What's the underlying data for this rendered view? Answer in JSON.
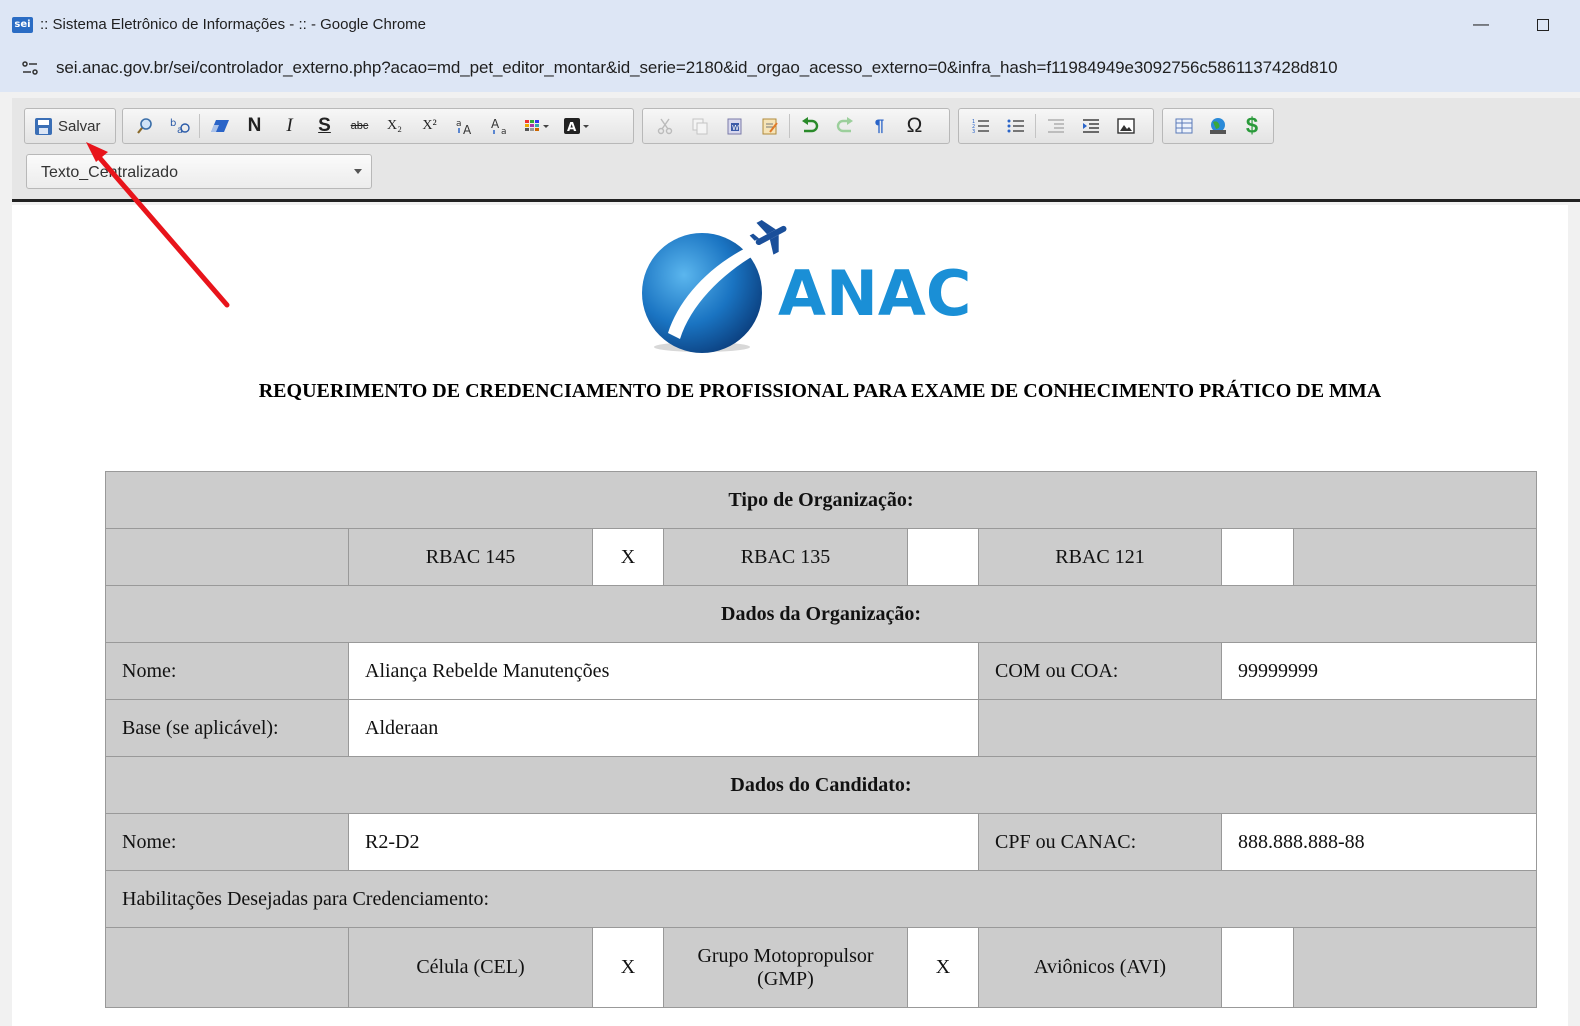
{
  "browser": {
    "favicon_label": "sei",
    "window_title": ":: Sistema Eletrônico de Informações - :: - Google Chrome",
    "minimize_glyph": "—",
    "url": "sei.anac.gov.br/sei/controlador_externo.php?acao=md_pet_editor_montar&id_serie=2180&id_orgao_acesso_externo=0&infra_hash=f11984949e3092756c5861137428d810"
  },
  "toolbar": {
    "save_label": "Salvar",
    "bold_glyph": "N",
    "italic_glyph": "I",
    "underline_glyph": "S",
    "strike_glyph": "abc",
    "subscript_glyph": "X₂",
    "superscript_glyph": "X²",
    "paragraph_glyph": "¶",
    "omega_glyph": "Ω",
    "dollar_glyph": "$",
    "style_select_value": "Texto_Centralizado"
  },
  "logo": {
    "text": "ANAC"
  },
  "document": {
    "heading": "REQUERIMENTO DE CREDENCIAMENTO DE PROFISSIONAL PARA EXAME DE CONHECIMENTO PRÁTICO DE MMA",
    "form": {
      "org_type_header": "Tipo de Organização:",
      "rbac145_label": "RBAC 145",
      "rbac145_mark": "X",
      "rbac135_label": "RBAC 135",
      "rbac135_mark": "",
      "rbac121_label": "RBAC 121",
      "rbac121_mark": "",
      "org_data_header": "Dados da Organização:",
      "org_name_label": "Nome:",
      "org_name_value": "Aliança Rebelde Manutenções",
      "com_coa_label": "COM ou COA:",
      "com_coa_value": "99999999",
      "base_label": "Base (se aplicável):",
      "base_value": "Alderaan",
      "candidate_header": "Dados do Candidato:",
      "candidate_name_label": "Nome:",
      "candidate_name_value": "R2-D2",
      "cpf_label": "CPF ou CANAC:",
      "cpf_value": "888.888.888-88",
      "qualifications_label": "Habilitações Desejadas para Credenciamento:",
      "cel_label": "Célula (CEL)",
      "cel_mark": "X",
      "gmp_label": "Grupo Motopropulsor (GMP)",
      "gmp_mark": "X",
      "avi_label": "Aviônicos (AVI)",
      "avi_mark": ""
    }
  },
  "colors": {
    "titlebar": "#dde6f5",
    "toolbar": "#e6e6e6",
    "table_gray": "#cccccc",
    "logo_blue": "#1a8fd6",
    "annotation_arrow": "#e8141b"
  },
  "icons": [
    "save-icon",
    "find-icon",
    "replace-icon",
    "eraser-icon",
    "cut-icon",
    "copy-icon",
    "paste-word-icon",
    "paste-text-icon",
    "undo-icon",
    "redo-icon",
    "ordered-list-icon",
    "bullet-list-icon",
    "outdent-icon",
    "indent-icon",
    "image-icon",
    "table-icon",
    "globe-icon",
    "dollar-icon"
  ]
}
